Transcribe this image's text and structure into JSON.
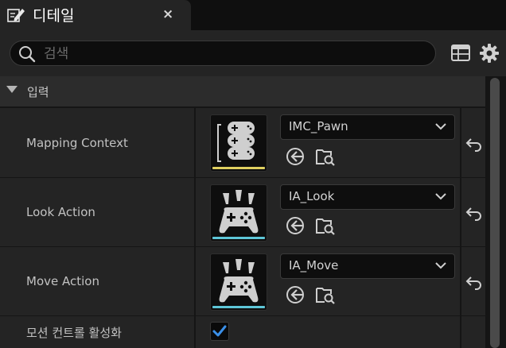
{
  "tab": {
    "title": "디테일",
    "close": "×"
  },
  "search": {
    "placeholder": "검색",
    "value": ""
  },
  "section": {
    "title": "입력"
  },
  "rows": [
    {
      "label": "Mapping Context",
      "asset": "IMC_Pawn",
      "thumb_bar": "#e0d060"
    },
    {
      "label": "Look Action",
      "asset": "IA_Look",
      "thumb_bar": "#5ec6d8"
    },
    {
      "label": "Move Action",
      "asset": "IA_Move",
      "thumb_bar": "#5ec6d8"
    }
  ],
  "motion": {
    "label": "모션 컨트롤 활성화",
    "checked": true
  },
  "colors": {
    "accent": "#3a8fe8",
    "panel": "#242424",
    "background": "#151515"
  },
  "icons": {
    "tab": "pencil-details-icon",
    "search": "search-icon",
    "table": "table-view-icon",
    "settings": "gear-icon",
    "use_asset": "use-selected-asset-icon",
    "browse": "browse-folder-icon",
    "reset": "reset-to-default-icon",
    "dropdown": "chevron-down-icon"
  }
}
